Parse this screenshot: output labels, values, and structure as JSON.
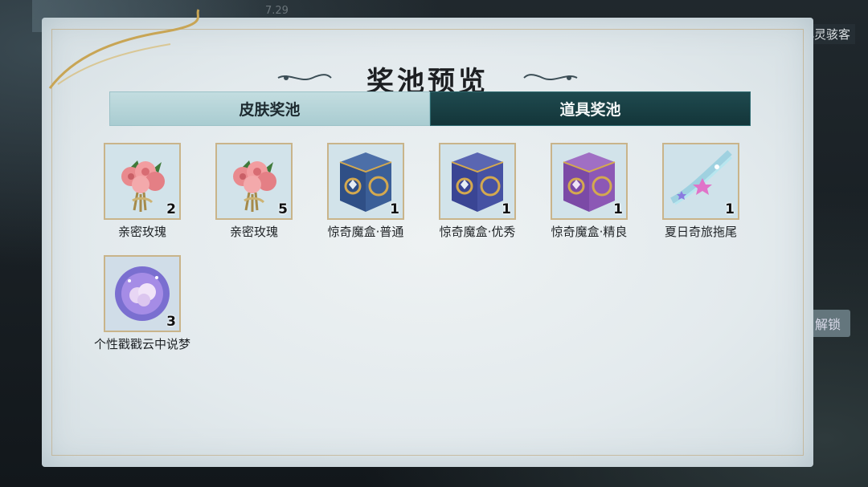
{
  "header": {
    "title": "奖池预览"
  },
  "tabs": [
    {
      "label": "皮肤奖池",
      "active": false
    },
    {
      "label": "道具奖池",
      "active": true
    }
  ],
  "items": [
    {
      "name": "亲密玫瑰",
      "count": "2",
      "icon": "rose-bouquet-icon"
    },
    {
      "name": "亲密玫瑰",
      "count": "5",
      "icon": "rose-bouquet-icon"
    },
    {
      "name": "惊奇魔盒·普通",
      "count": "1",
      "icon": "blue-mystery-box-icon"
    },
    {
      "name": "惊奇魔盒·优秀",
      "count": "1",
      "icon": "indigo-mystery-box-icon"
    },
    {
      "name": "惊奇魔盒·精良",
      "count": "1",
      "icon": "purple-mystery-box-icon"
    },
    {
      "name": "夏日奇旅拖尾",
      "count": "1",
      "icon": "star-trail-icon"
    },
    {
      "name": "个性戳戳云中说梦",
      "count": "3",
      "icon": "dream-cloud-icon"
    }
  ],
  "background": {
    "top_text": "7.29",
    "right_text": "心灵骇客",
    "unlock_label": "解锁"
  },
  "colors": {
    "active_tab": "#133539",
    "inactive_tab": "#a9ccd1",
    "thumb_border": "#c9b48a"
  }
}
